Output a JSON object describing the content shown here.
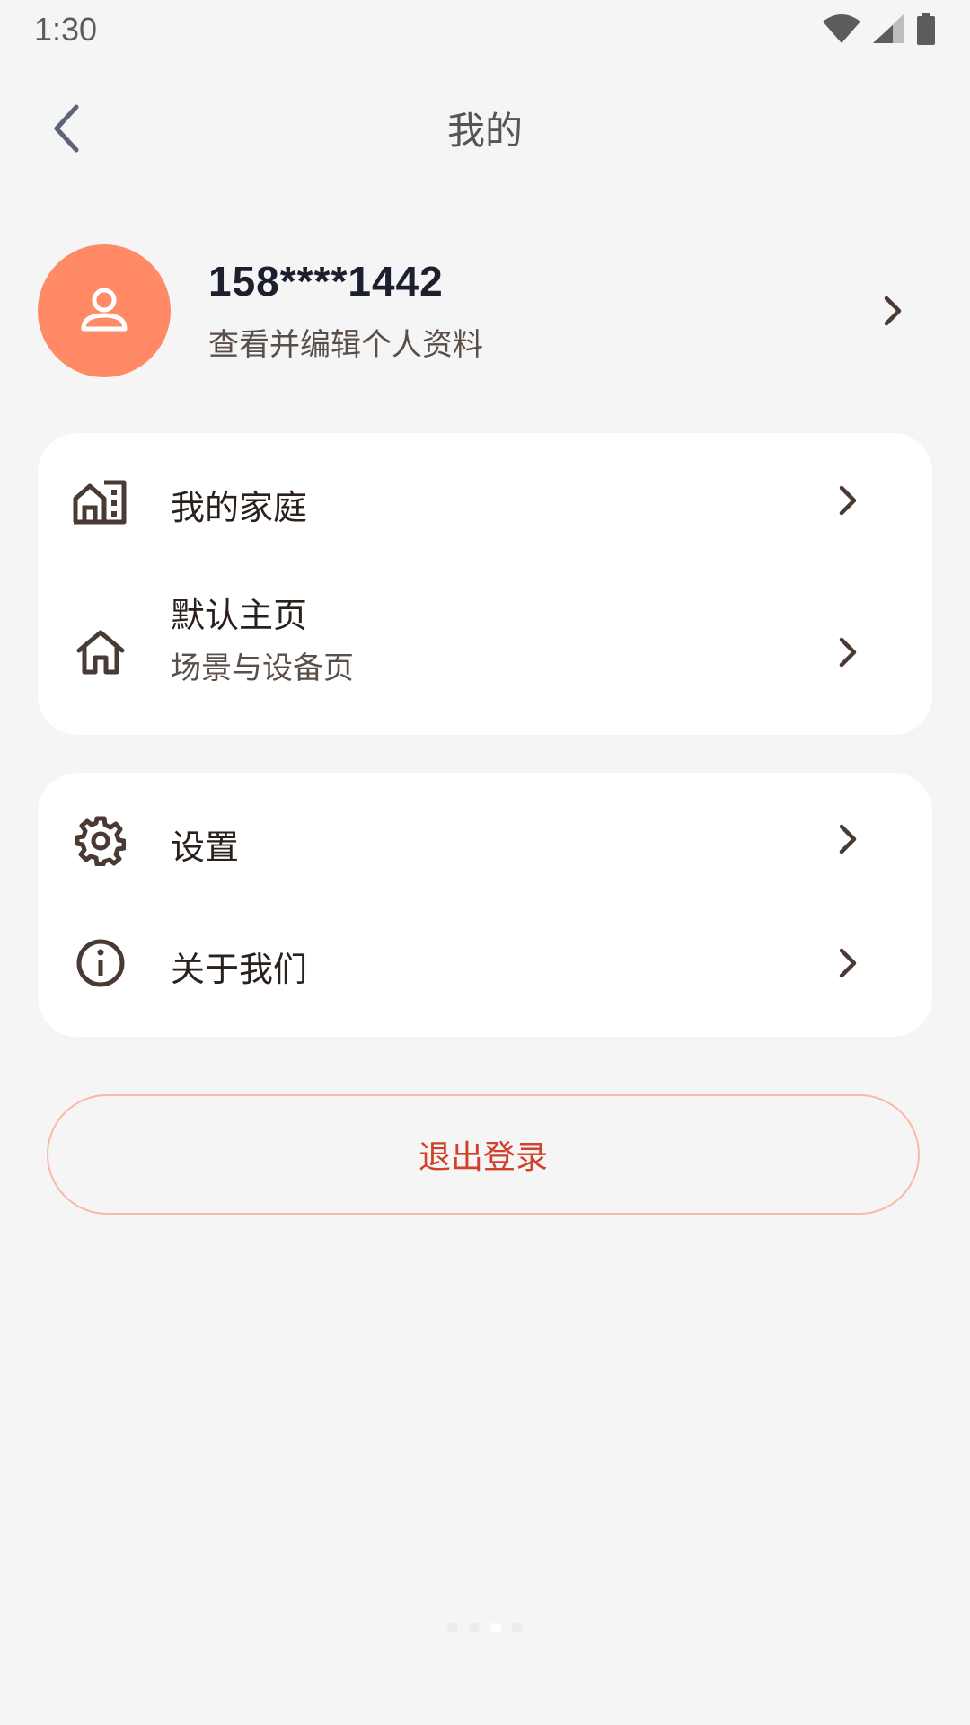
{
  "status_bar": {
    "time": "1:30",
    "icons": [
      "wifi-icon",
      "signal-icon",
      "battery-icon"
    ]
  },
  "header": {
    "title": "我的",
    "back_icon": "chevron-left-icon"
  },
  "profile": {
    "phone": "158****1442",
    "subtitle": "查看并编辑个人资料",
    "avatar_icon": "user-icon",
    "avatar_color": "#ff8a65"
  },
  "menu_groups": [
    {
      "items": [
        {
          "label": "我的家庭",
          "icon": "building-home-icon"
        },
        {
          "label": "默认主页",
          "sub": "场景与设备页",
          "icon": "house-icon"
        }
      ]
    },
    {
      "items": [
        {
          "label": "设置",
          "icon": "gear-icon"
        },
        {
          "label": "关于我们",
          "icon": "info-icon"
        }
      ]
    }
  ],
  "logout": {
    "label": "退出登录",
    "text_color": "#d0402a",
    "border_color": "#f9b9a6"
  },
  "page_indicator": {
    "count": 4,
    "active": 3
  }
}
